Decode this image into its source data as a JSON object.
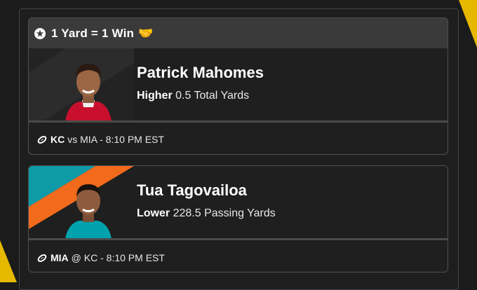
{
  "promo": {
    "title": "1 Yard = 1 Win",
    "star_icon": "star-circle-icon",
    "handshake_icon": "handshake-emoji-icon"
  },
  "picks": [
    {
      "player": "Patrick Mahomes",
      "direction": "Higher",
      "line": "0.5 Total Yards",
      "team": "KC",
      "matchup_rest": "vs MIA - 8:10 PM EST",
      "jersey_color": "#c8102e"
    },
    {
      "player": "Tua Tagovailoa",
      "direction": "Lower",
      "line": "228.5 Passing Yards",
      "team": "MIA",
      "matchup_rest": "@ KC - 8:10 PM EST",
      "stripe_colors": [
        "#0e9aa7",
        "#f26a1b"
      ],
      "jersey_color": "#00a3ad"
    }
  ],
  "colors": {
    "accent": "#e6b800",
    "card_bg": "#1f1f1f",
    "header_bg": "#3a3a3a"
  }
}
